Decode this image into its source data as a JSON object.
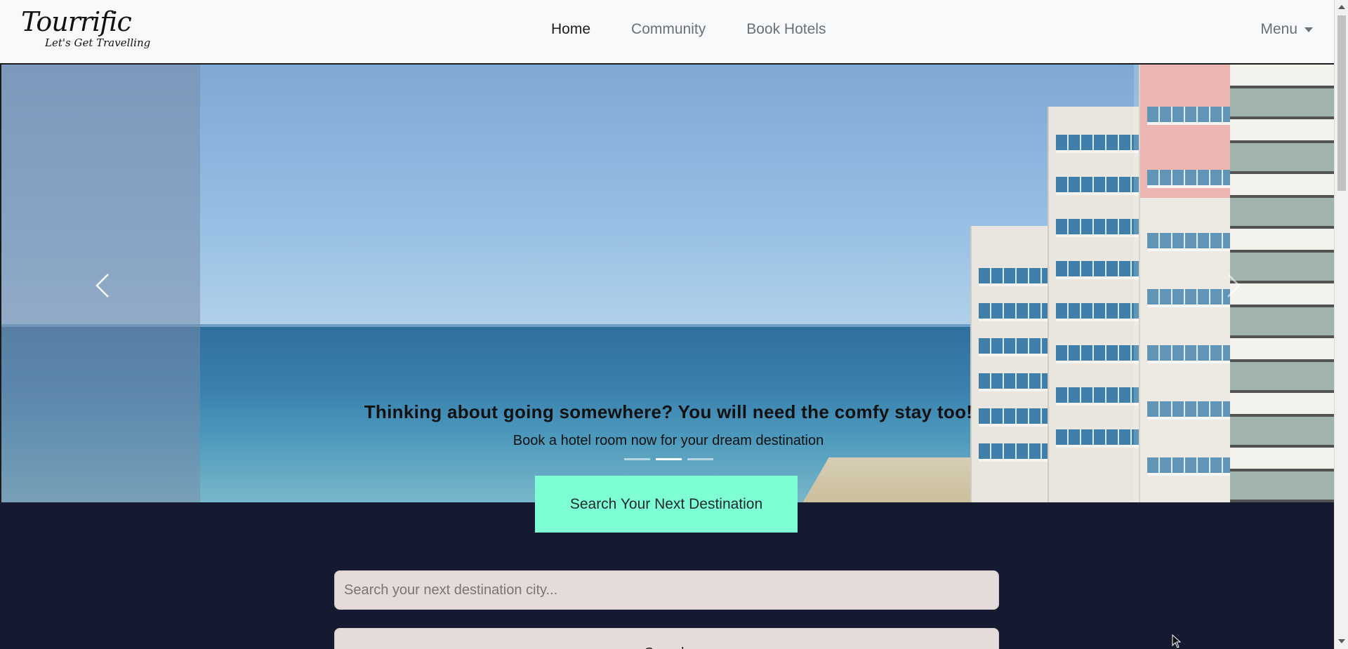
{
  "brand": {
    "title": "Tourrific",
    "tagline": "Let's Get Travelling"
  },
  "nav": {
    "links": [
      {
        "label": "Home",
        "active": true
      },
      {
        "label": "Community",
        "active": false
      },
      {
        "label": "Book Hotels",
        "active": false
      }
    ],
    "menu_label": "Menu"
  },
  "carousel": {
    "caption_title": "Thinking about going somewhere? You will need the comfy stay too!",
    "caption_text": "Book a hotel room now for your dream destination",
    "slides_count": 3,
    "active_slide": 2
  },
  "cta": {
    "label": "Search Your Next Destination"
  },
  "search": {
    "placeholder": "Search your next destination city...",
    "value": "",
    "button_label": "Search"
  },
  "colors": {
    "accent": "#7efed3",
    "page_bg": "#151a30",
    "navbar_bg": "#f8f9fb",
    "input_bg": "#e4dbda"
  }
}
